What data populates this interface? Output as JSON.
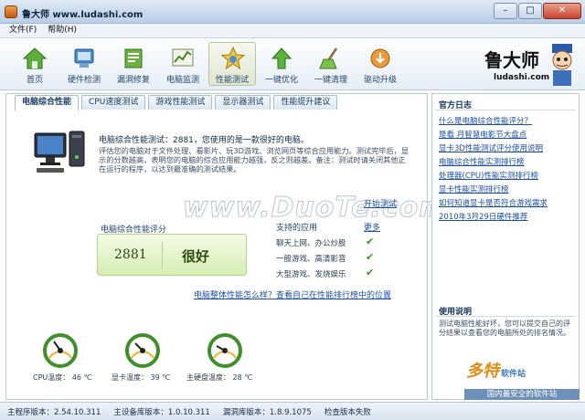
{
  "window": {
    "title": "鲁大师 www.ludashi.com",
    "controls": {
      "minimize": "–",
      "maximize": "□",
      "close": "✕"
    }
  },
  "menu": {
    "file": "文件(F)",
    "help": "帮助(H)"
  },
  "toolbar": {
    "items": [
      {
        "label": "首页",
        "icon": "home-icon"
      },
      {
        "label": "硬件检测",
        "icon": "hardware-detect-icon"
      },
      {
        "label": "漏洞修复",
        "icon": "patch-fix-icon"
      },
      {
        "label": "电脑监测",
        "icon": "monitor-chart-icon"
      },
      {
        "label": "性能测试",
        "icon": "star-performance-icon"
      },
      {
        "label": "一键优化",
        "icon": "optimize-arrow-icon"
      },
      {
        "label": "一键清理",
        "icon": "broom-clean-icon"
      },
      {
        "label": "驱动升级",
        "icon": "driver-update-icon"
      }
    ],
    "active_index": 4
  },
  "brand": {
    "name": "鲁大师",
    "url": "ludashi.com"
  },
  "tabs": [
    "电脑综合性能",
    "CPU速度测试",
    "游戏性能测试",
    "显示器测试",
    "性能提升建议"
  ],
  "active_tab": 0,
  "summary": {
    "score_line": "电脑综合性能测试：2881，您使用的是一款很好的电脑。",
    "description": "评估您的电脑对于文件处理、看影片、玩3D游戏、浏览网页等综合应用能力。测试完毕后，显示的分数越高，表明您的电脑的综合应用能力越强，反之则越差。备注：测试时请关闭其他正在运行的程序，以达到最准确的测试结果。"
  },
  "watermark": "www.DuoTe.com",
  "rating": {
    "title": "电脑综合性能评分",
    "score": "2881",
    "level": "很好",
    "retest": "开始测试",
    "more": "更多",
    "apps_title": "支持的应用",
    "apps": [
      "聊天上网、办公炒股",
      "一般游戏、高清影音",
      "大型游戏、发烧娱乐"
    ],
    "rank_link": "电脑整体性能怎么样？查看自己在性能排行榜中的位置"
  },
  "gauges": [
    {
      "label": "CPU温度：",
      "value": "46 ℃"
    },
    {
      "label": "显卡温度：",
      "value": "39 ℃"
    },
    {
      "label": "主硬盘温度：",
      "value": "28 ℃"
    }
  ],
  "sidebar": {
    "news_title": "官方日志",
    "news": [
      "什么是电脑综合性能评分？",
      "是看 月智慧电影节大盘点",
      "显卡3D性能测试评分使用说明",
      "电脑综合性能实测排行榜",
      "处理器(CPU)性能实测排行榜",
      "显卡性能实测排行榜",
      "如何知道显卡是否符合游戏需求",
      "2010年3月29日硬件推荐"
    ],
    "help_title": "使用说明",
    "help_text": "测试电脑性能好坏，您可以提交自己的评分结果以查看您的电脑所处的排名情况。",
    "logo_text": "多特",
    "logo_small": "软件站",
    "banner": "国内最安全的软件站"
  },
  "status": {
    "main_version": "主程序版本：2.54.10.311",
    "device_db": "主设备库版本：1.0.10.311",
    "vuln_db": "漏洞库版本：1.8.9.1075",
    "check": "检查版本失败"
  },
  "colors": {
    "accent_green": "#2e9b1c",
    "link_blue": "#1c4ea6",
    "frame": "#b5c7dc"
  }
}
